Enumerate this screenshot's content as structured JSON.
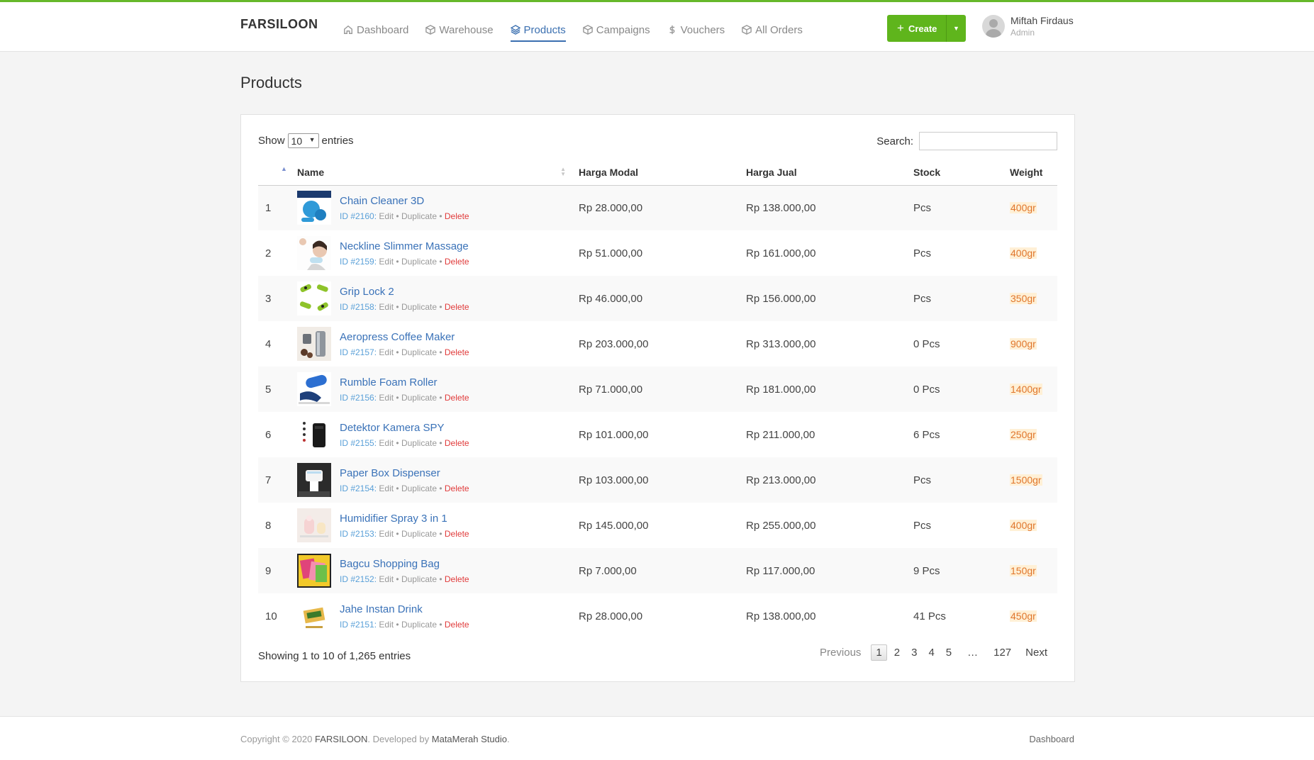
{
  "header": {
    "brand": "FARSILOON",
    "nav": [
      {
        "label": "Dashboard",
        "icon": "home-icon",
        "active": false
      },
      {
        "label": "Warehouse",
        "icon": "box-icon",
        "active": false
      },
      {
        "label": "Products",
        "icon": "layers-icon",
        "active": true
      },
      {
        "label": "Campaigns",
        "icon": "box-icon",
        "active": false
      },
      {
        "label": "Vouchers",
        "icon": "dollar-icon",
        "active": false
      },
      {
        "label": "All Orders",
        "icon": "box-icon",
        "active": false
      }
    ],
    "create_label": "Create",
    "user_name": "Miftah Firdaus",
    "user_role": "Admin"
  },
  "page": {
    "title": "Products"
  },
  "table_controls": {
    "show_label": "Show",
    "page_size": "10",
    "entries_label": "entries",
    "search_label": "Search:",
    "search_value": ""
  },
  "columns": [
    "Name",
    "Harga Modal",
    "Harga Jual",
    "Stock",
    "Weight"
  ],
  "rows": [
    {
      "no": "1",
      "name": "Chain Cleaner 3D",
      "id": "ID #2160:",
      "modal": "Rp 28.000,00",
      "jual": "Rp 138.000,00",
      "stock": "Pcs",
      "weight": "400gr",
      "thumb": "blue-gear"
    },
    {
      "no": "2",
      "name": "Neckline Slimmer Massage",
      "id": "ID #2159:",
      "modal": "Rp 51.000,00",
      "jual": "Rp 161.000,00",
      "stock": "Pcs",
      "weight": "400gr",
      "thumb": "face"
    },
    {
      "no": "3",
      "name": "Grip Lock 2",
      "id": "ID #2158:",
      "modal": "Rp 46.000,00",
      "jual": "Rp 156.000,00",
      "stock": "Pcs",
      "weight": "350gr",
      "thumb": "green-grips"
    },
    {
      "no": "4",
      "name": "Aeropress Coffee Maker",
      "id": "ID #2157:",
      "modal": "Rp 203.000,00",
      "jual": "Rp 313.000,00",
      "stock": "0 Pcs",
      "weight": "900gr",
      "thumb": "steel"
    },
    {
      "no": "5",
      "name": "Rumble Foam Roller",
      "id": "ID #2156:",
      "modal": "Rp 71.000,00",
      "jual": "Rp 181.000,00",
      "stock": "0 Pcs",
      "weight": "1400gr",
      "thumb": "blue-roller"
    },
    {
      "no": "6",
      "name": "Detektor Kamera SPY",
      "id": "ID #2155:",
      "modal": "Rp 101.000,00",
      "jual": "Rp 211.000,00",
      "stock": "6 Pcs",
      "weight": "250gr",
      "thumb": "black-device"
    },
    {
      "no": "7",
      "name": "Paper Box Dispenser",
      "id": "ID #2154:",
      "modal": "Rp 103.000,00",
      "jual": "Rp 213.000,00",
      "stock": "Pcs",
      "weight": "1500gr",
      "thumb": "dispenser"
    },
    {
      "no": "8",
      "name": "Humidifier Spray 3 in 1",
      "id": "ID #2153:",
      "modal": "Rp 145.000,00",
      "jual": "Rp 255.000,00",
      "stock": "Pcs",
      "weight": "400gr",
      "thumb": "pink"
    },
    {
      "no": "9",
      "name": "Bagcu Shopping Bag",
      "id": "ID #2152:",
      "modal": "Rp 7.000,00",
      "jual": "Rp 117.000,00",
      "stock": "9 Pcs",
      "weight": "150gr",
      "thumb": "bags"
    },
    {
      "no": "10",
      "name": "Jahe Instan Drink",
      "id": "ID #2151:",
      "modal": "Rp 28.000,00",
      "jual": "Rp 138.000,00",
      "stock": "41 Pcs",
      "weight": "450gr",
      "thumb": "box"
    }
  ],
  "row_actions": {
    "edit": "Edit",
    "duplicate": "Duplicate",
    "delete": "Delete",
    "sep": "•"
  },
  "pagination": {
    "info": "Showing 1 to 10 of 1,265 entries",
    "previous": "Previous",
    "pages": [
      "1",
      "2",
      "3",
      "4",
      "5"
    ],
    "dots": "…",
    "last": "127",
    "next": "Next"
  },
  "footer": {
    "copyright_prefix": "Copyright © 2020",
    "brand": "FARSILOON",
    "developed_by": ". Developed by",
    "studio": "MataMerah Studio",
    "dot": ".",
    "link": "Dashboard"
  },
  "colors": {
    "accent": "#5fb51c",
    "link": "#3a72b8",
    "danger": "#e03a3a",
    "weight_bg": "#fff0d6"
  }
}
